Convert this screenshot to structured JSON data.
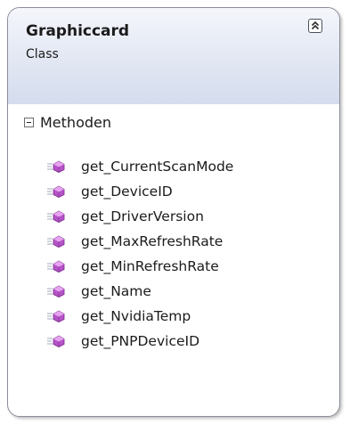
{
  "class_box": {
    "name": "Graphiccard",
    "kind": "Class",
    "collapse_icon": "double-chevron-up-icon",
    "section": {
      "label": "Methoden",
      "expander_icon": "minus-box-icon",
      "member_icon": "method-cube-icon",
      "methods": [
        "get_CurrentScanMode",
        "get_DeviceID",
        "get_DriverVersion",
        "get_MaxRefreshRate",
        "get_MinRefreshRate",
        "get_Name",
        "get_NvidiaTemp",
        "get_PNPDeviceID"
      ]
    }
  },
  "colors": {
    "header_gradient_top": "#f4f6fb",
    "header_gradient_bottom": "#d4dcee",
    "border": "#8a8f99",
    "method_icon": "#b653c8"
  }
}
